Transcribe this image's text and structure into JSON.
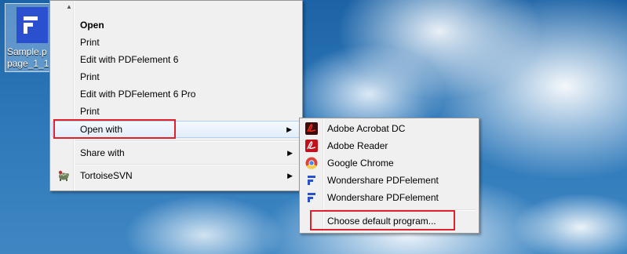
{
  "desktop_icon": {
    "label_line1": "Sample.p",
    "label_line2": "page_1_1.p"
  },
  "context_menu": {
    "items": [
      {
        "label": "Open"
      },
      {
        "label": "Print"
      },
      {
        "label": "Edit with PDFelement 6"
      },
      {
        "label": "Print"
      },
      {
        "label": "Edit with PDFelement 6 Pro"
      },
      {
        "label": "Print"
      },
      {
        "label": "Open with"
      },
      {
        "label": "Share with"
      },
      {
        "label": "TortoiseSVN"
      }
    ],
    "highlight_color": "#e0202a"
  },
  "submenu": {
    "items": [
      {
        "label": "Adobe Acrobat DC",
        "icon": "acrobat-icon"
      },
      {
        "label": "Adobe Reader",
        "icon": "adobe-reader-icon"
      },
      {
        "label": "Google Chrome",
        "icon": "chrome-icon"
      },
      {
        "label": "Wondershare PDFelement",
        "icon": "pdfelement-icon"
      },
      {
        "label": "Wondershare PDFelement",
        "icon": "pdfelement-icon"
      },
      {
        "label": "Choose default program...",
        "icon": ""
      }
    ]
  }
}
